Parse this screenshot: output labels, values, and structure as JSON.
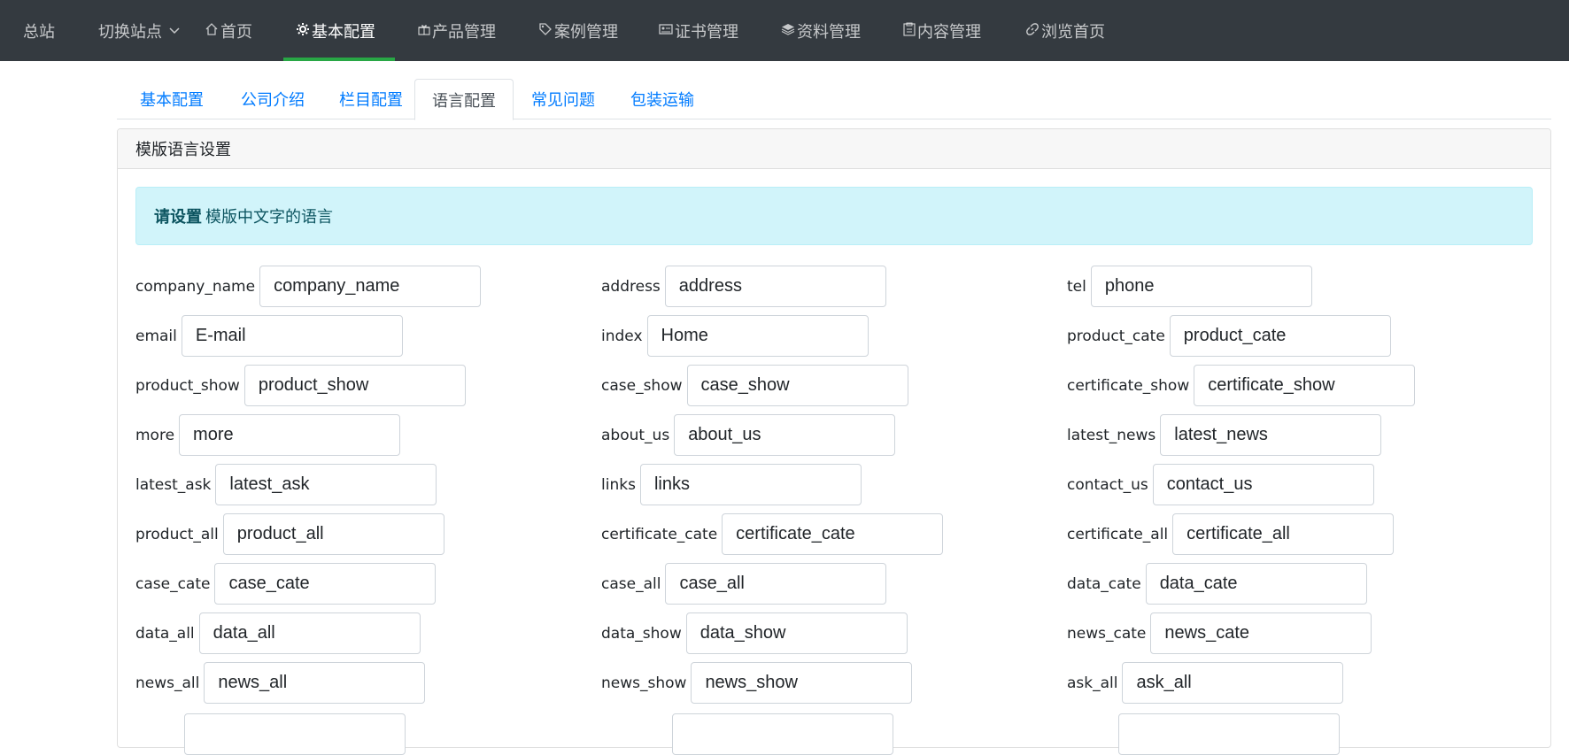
{
  "navbar": {
    "items": [
      {
        "label": "总站",
        "icon": ""
      },
      {
        "label": "切换站点",
        "icon": "",
        "dropdown": true
      },
      {
        "label": "首页",
        "icon": "home-icon"
      },
      {
        "label": "基本配置",
        "icon": "gear-icon",
        "active": true
      },
      {
        "label": "产品管理",
        "icon": "gift-icon"
      },
      {
        "label": "案例管理",
        "icon": "tag-icon"
      },
      {
        "label": "证书管理",
        "icon": "card-icon"
      },
      {
        "label": "资料管理",
        "icon": "layers-icon"
      },
      {
        "label": "内容管理",
        "icon": "clipboard-icon"
      },
      {
        "label": "浏览首页",
        "icon": "link-icon"
      }
    ],
    "colors": {
      "background": "#343a40",
      "active_underline": "#28a745"
    }
  },
  "tabs": [
    {
      "label": "基本配置"
    },
    {
      "label": "公司介绍"
    },
    {
      "label": "栏目配置"
    },
    {
      "label": "语言配置",
      "active": true
    },
    {
      "label": "常见问题"
    },
    {
      "label": "包装运输"
    }
  ],
  "card": {
    "header": "模版语言设置",
    "alert": {
      "bold": "请设置",
      "text": "模版中文字的语言"
    }
  },
  "fields": [
    {
      "label": "company_name",
      "value": "company_name"
    },
    {
      "label": "address",
      "value": "address"
    },
    {
      "label": "tel",
      "value": "phone"
    },
    {
      "label": "email",
      "value": "E-mail"
    },
    {
      "label": "index",
      "value": "Home"
    },
    {
      "label": "product_cate",
      "value": "product_cate"
    },
    {
      "label": "product_show",
      "value": "product_show"
    },
    {
      "label": "case_show",
      "value": "case_show"
    },
    {
      "label": "certificate_show",
      "value": "certificate_show"
    },
    {
      "label": "more",
      "value": "more"
    },
    {
      "label": "about_us",
      "value": "about_us"
    },
    {
      "label": "latest_news",
      "value": "latest_news"
    },
    {
      "label": "latest_ask",
      "value": "latest_ask"
    },
    {
      "label": "links",
      "value": "links"
    },
    {
      "label": "contact_us",
      "value": "contact_us"
    },
    {
      "label": "product_all",
      "value": "product_all"
    },
    {
      "label": "certificate_cate",
      "value": "certificate_cate"
    },
    {
      "label": "certificate_all",
      "value": "certificate_all"
    },
    {
      "label": "case_cate",
      "value": "case_cate"
    },
    {
      "label": "case_all",
      "value": "case_all"
    },
    {
      "label": "data_cate",
      "value": "data_cate"
    },
    {
      "label": "data_all",
      "value": "data_all"
    },
    {
      "label": "data_show",
      "value": "data_show"
    },
    {
      "label": "news_cate",
      "value": "news_cate"
    },
    {
      "label": "news_all",
      "value": "news_all"
    },
    {
      "label": "news_show",
      "value": "news_show"
    },
    {
      "label": "ask_all",
      "value": "ask_all"
    }
  ]
}
